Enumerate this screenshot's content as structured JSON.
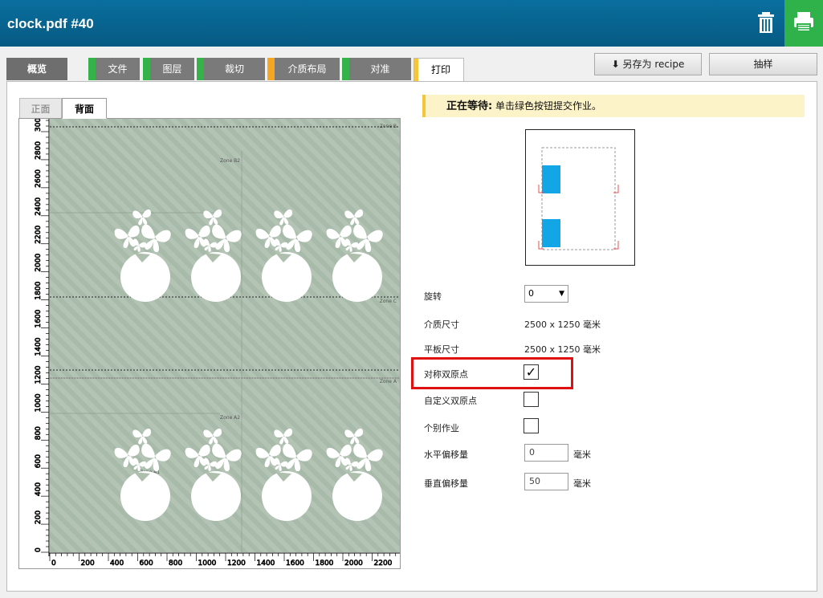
{
  "header": {
    "title": "clock.pdf #40"
  },
  "tabs": [
    {
      "label": "概览",
      "color": "#7a7a7a"
    },
    {
      "label": "文件",
      "color": "#35b34a"
    },
    {
      "label": "图层",
      "color": "#35b34a"
    },
    {
      "label": "裁切",
      "color": "#35b34a"
    },
    {
      "label": "介质布局",
      "color": "#f5a623"
    },
    {
      "label": "对准",
      "color": "#35b34a"
    },
    {
      "label": "打印",
      "color": "#f5c53a"
    }
  ],
  "toolbar": {
    "save_recipe_label": "另存为 recipe",
    "sample_label": "抽样"
  },
  "side_tabs": {
    "front": "正面",
    "back": "背面"
  },
  "preview": {
    "zones": [
      "Zone B",
      "Zone B2",
      "Zone C",
      "Zone A",
      "Zone A2",
      "Zone A1"
    ],
    "y_ticks": [
      "0",
      "200",
      "400",
      "600",
      "800",
      "1000",
      "1200",
      "1400",
      "1600",
      "1800",
      "2000",
      "2200",
      "2400",
      "2600",
      "2800",
      "3000"
    ],
    "x_ticks": [
      "0",
      "200",
      "400",
      "600",
      "800",
      "1000",
      "1200",
      "1400",
      "1600",
      "1800",
      "2000",
      "2200",
      "24"
    ]
  },
  "status": {
    "bold": "正在等待:",
    "text": " 单击绿色按钮提交作业。"
  },
  "form": {
    "rotate_label": "旋转",
    "rotate_value": "0",
    "media_size_label": "介质尺寸",
    "media_size_value": "2500 x 1250 毫米",
    "table_size_label": "平板尺寸",
    "table_size_value": "2500 x 1250 毫米",
    "sym_label": "对称双原点",
    "sym_checked": "✓",
    "custom_label": "自定义双原点",
    "individual_label": "个别作业",
    "h_offset_label": "水平偏移量",
    "h_offset_value": "0",
    "h_unit": "毫米",
    "v_offset_label": "垂直偏移量",
    "v_offset_value": "50",
    "v_unit": "毫米"
  },
  "colors": {
    "accent_green": "#2fb24a",
    "highlight_red": "#e01010",
    "thumb_blue": "#12a6e6"
  }
}
